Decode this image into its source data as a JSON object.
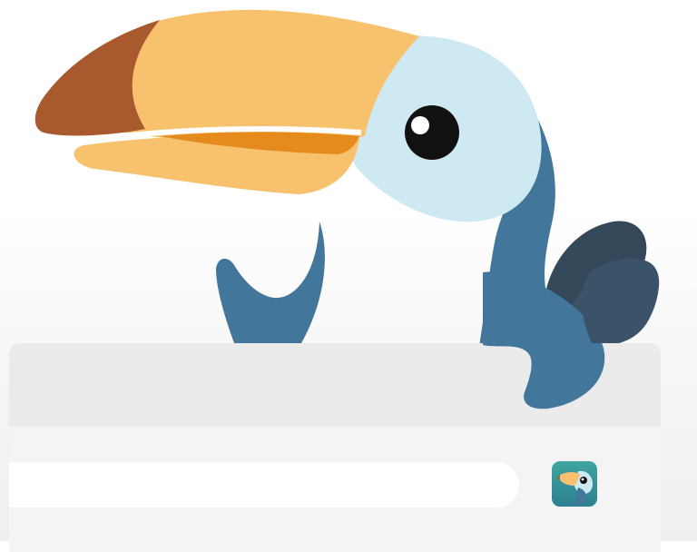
{
  "browser": {
    "address_bar": {
      "value": ""
    },
    "extension": {
      "icon": "toucan-icon"
    }
  },
  "colors": {
    "beak_orange": "#f7c16e",
    "beak_tip": "#a85a2e",
    "beak_stripe": "#e58a1c",
    "face_light": "#cfe9f3",
    "body_blue": "#42769a",
    "wing_dark": "#34485a",
    "wing_mid": "#3b5368",
    "eye": "#111111",
    "tab_strip": "#ebebeb",
    "toolbar": "#f4f4f4",
    "address_bar": "#ffffff"
  }
}
